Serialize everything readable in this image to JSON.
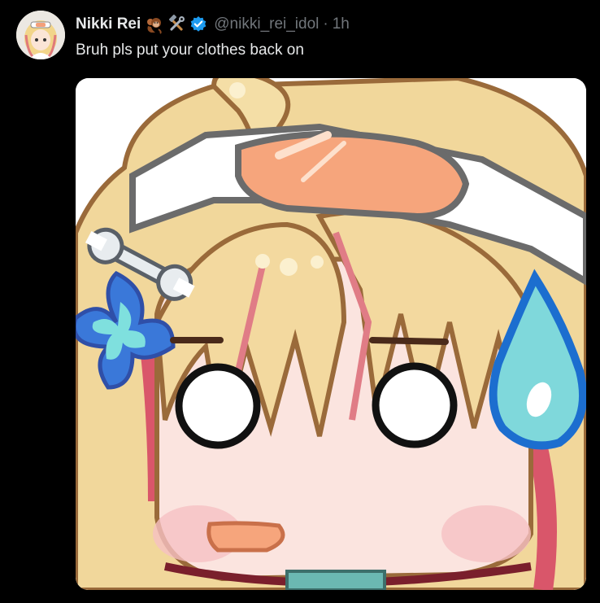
{
  "post": {
    "author": {
      "display_name": "Nikki Rei",
      "name_emojis": [
        "monkey-emoji",
        "hammer-and-wrench-emoji"
      ],
      "verified": true,
      "handle": "@nikki_rei_idol",
      "separator": "·",
      "time": "1h"
    },
    "text": "Bruh pls put your clothes back on",
    "media": {
      "type": "image",
      "subject": "chibi-girl-sweat-drop"
    }
  },
  "colors": {
    "background": "#000000",
    "text_primary": "#e7e9ea",
    "text_secondary": "#71767b",
    "verified_badge": "#1d9bf0"
  }
}
